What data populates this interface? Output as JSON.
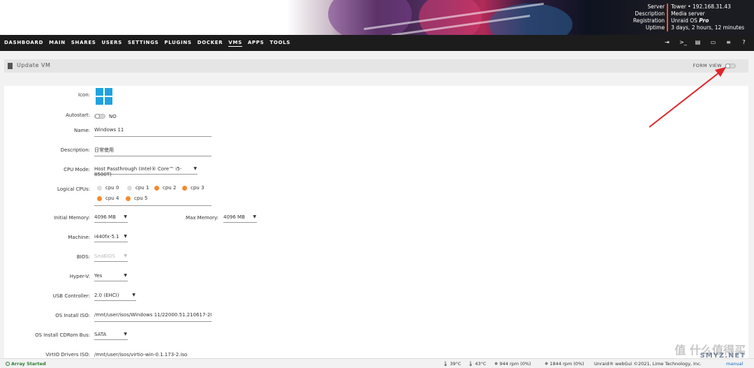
{
  "server_info": {
    "keys": [
      "Server",
      "Description",
      "Registration",
      "Uptime"
    ],
    "server": "Tower • 192.168.31.43",
    "description": "Media server",
    "registration_prefix": "Unraid OS ",
    "registration_tier": "Pro",
    "uptime": "3 days, 2 hours, 12 minutes"
  },
  "nav": {
    "items": [
      "DASHBOARD",
      "MAIN",
      "SHARES",
      "USERS",
      "SETTINGS",
      "PLUGINS",
      "DOCKER",
      "VMS",
      "APPS",
      "TOOLS"
    ],
    "active": "VMS",
    "icons": [
      "logout-icon",
      "terminal-icon",
      "feedback-icon",
      "display-icon",
      "log-icon",
      "help-icon"
    ]
  },
  "titlebar": {
    "title": "Update VM",
    "form_view_label": "FORM VIEW"
  },
  "form": {
    "icon_label": "Icon:",
    "autostart_label": "Autostart:",
    "autostart_value": "NO",
    "name_label": "Name:",
    "name_value": "Windows 11",
    "description_label": "Description:",
    "description_value": "日常使用",
    "cpu_mode_label": "CPU Mode:",
    "cpu_mode_value": "Host Passthrough (Intel® Core™ i5-8500T)",
    "logical_cpus_label": "Logical CPUs:",
    "cpus": [
      {
        "name": "cpu 0",
        "selected": false
      },
      {
        "name": "cpu 1",
        "selected": false
      },
      {
        "name": "cpu 2",
        "selected": true
      },
      {
        "name": "cpu 3",
        "selected": true
      },
      {
        "name": "cpu 4",
        "selected": true
      },
      {
        "name": "cpu 5",
        "selected": true
      }
    ],
    "initial_memory_label": "Initial Memory:",
    "initial_memory_value": "4096 MB",
    "max_memory_label": "Max Memory:",
    "max_memory_value": "4096 MB",
    "machine_label": "Machine:",
    "machine_value": "i440fx-5.1",
    "bios_label": "BIOS:",
    "bios_value": "SeaBIOS",
    "hyperv_label": "Hyper-V:",
    "hyperv_value": "Yes",
    "usb_label": "USB Controller:",
    "usb_value": "2.0 (EHCI)",
    "os_iso_label": "OS Install ISO:",
    "os_iso_value": "/mnt/user/isos/Windows 11/22000.51.210617-20",
    "cdrom_bus_label": "OS Install CDRom Bus:",
    "cdrom_bus_value": "SATA",
    "virtio_label": "VirtIO Drivers ISO:",
    "virtio_value": "/mnt/user/isos/virtio-win-0.1.173-2.iso"
  },
  "status": {
    "array": "Array Started",
    "cpu_temp": "39°C",
    "mb_temp": "43°C",
    "fan1": "944 rpm (0%)",
    "fan2": "1844 rpm (0%)",
    "footer": "Unraid® webGui ©2021, Lime Technology, Inc.",
    "manual": "manual"
  },
  "watermark": {
    "line1": "值 什么值得买",
    "line2": "SMYZ.NET"
  },
  "colors": {
    "nav_bg": "#1c1c1c",
    "accent_orange": "#f5892e",
    "windows_blue": "#1fa3e0",
    "arrow_red": "#e0242b",
    "array_green": "#2e7d32"
  }
}
